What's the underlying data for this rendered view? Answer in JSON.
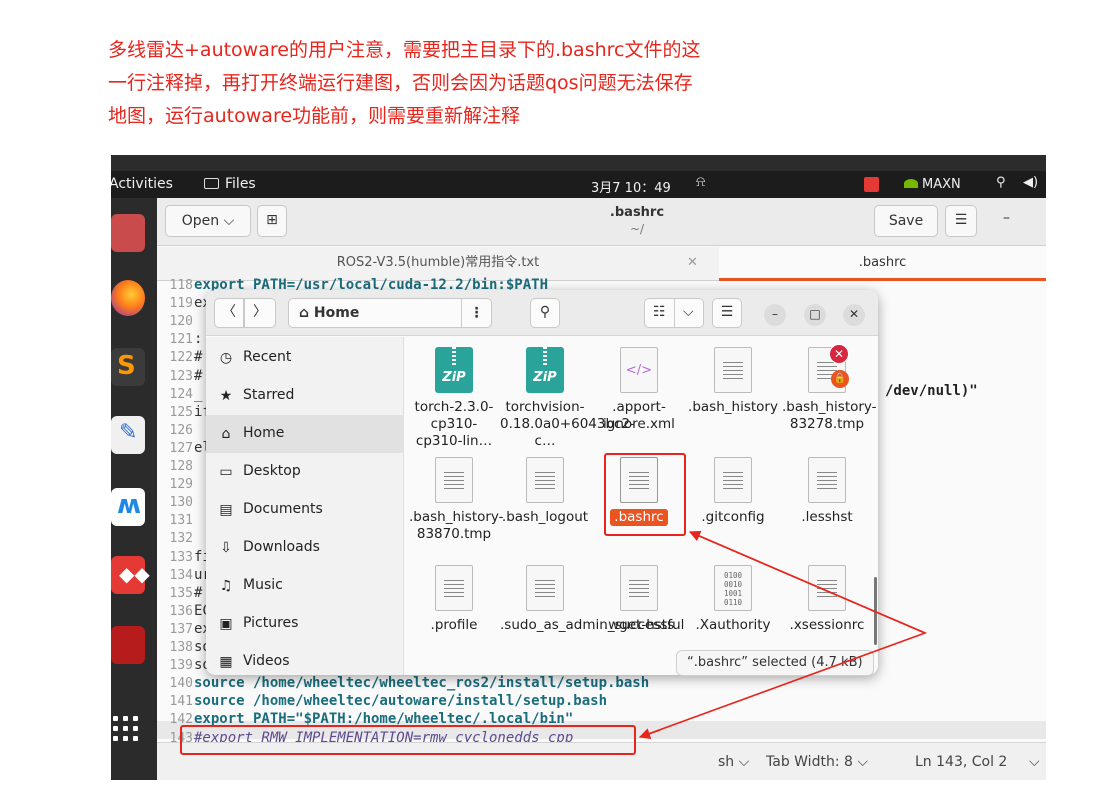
{
  "annotation": {
    "line1": "多线雷达+autoware的用户注意，需要把主目录下的.bashrc文件的这",
    "line2": "一行注释掉，再打开终端运行建图，否则会因为话题qos问题无法保存",
    "line3": "地图，运行autoware功能前，则需要重新解注释"
  },
  "topbar": {
    "activities": "Activities",
    "app": "Files",
    "clock": "3月7 10：49",
    "maxn": "MAXN"
  },
  "gedit": {
    "open_label": "Open",
    "save_label": "Save",
    "title": ".bashrc",
    "path": "~/",
    "tabs": [
      {
        "label": "ROS2-V3.5(humble)常用指令.txt"
      },
      {
        "label": ".bashrc"
      }
    ],
    "lines": [
      {
        "n": "118",
        "t": "export PATH=/usr/local/cuda-12.2/bin:$PATH"
      },
      {
        "n": "119",
        "t": "ex"
      },
      {
        "n": "120",
        "t": ""
      },
      {
        "n": "121",
        "t": ":"
      },
      {
        "n": "122",
        "t": "#"
      },
      {
        "n": "123",
        "t": "#"
      },
      {
        "n": "124",
        "t": "_"
      },
      {
        "n": "125",
        "t": "if"
      },
      {
        "n": "126",
        "t": ""
      },
      {
        "n": "127",
        "t": "el"
      },
      {
        "n": "128",
        "t": ""
      },
      {
        "n": "129",
        "t": ""
      },
      {
        "n": "130",
        "t": ""
      },
      {
        "n": "131",
        "t": ""
      },
      {
        "n": "132",
        "t": ""
      },
      {
        "n": "133",
        "t": "fi"
      },
      {
        "n": "134",
        "t": "ur"
      },
      {
        "n": "135",
        "t": "#"
      },
      {
        "n": "136",
        "t": "EC"
      },
      {
        "n": "137",
        "t": "ex"
      },
      {
        "n": "138",
        "t": "so"
      },
      {
        "n": "139",
        "t": "so"
      },
      {
        "n": "140",
        "t": "source /home/wheeltec/wheeltec_ros2/install/setup.bash"
      },
      {
        "n": "141",
        "t": "source /home/wheeltec/autoware/install/setup.bash"
      },
      {
        "n": "142",
        "t": "export PATH=\"$PATH:/home/wheeltec/.local/bin\""
      },
      {
        "n": "143",
        "t": "#export RMW_IMPLEMENTATION=rmw_cyclonedds_cpp"
      }
    ],
    "dev_null": "/dev/null)\"",
    "status": {
      "lang": "sh",
      "tab_width": "Tab Width: 8",
      "position": "Ln 143, Col 2"
    }
  },
  "files": {
    "location": "Home",
    "sidebar": [
      {
        "icon": "clock-icon",
        "glyph": "◷",
        "label": "Recent"
      },
      {
        "icon": "star-icon",
        "glyph": "★",
        "label": "Starred"
      },
      {
        "icon": "home-icon",
        "glyph": "⌂",
        "label": "Home"
      },
      {
        "icon": "desktop-icon",
        "glyph": "▭",
        "label": "Desktop"
      },
      {
        "icon": "documents-icon",
        "glyph": "▤",
        "label": "Documents"
      },
      {
        "icon": "downloads-icon",
        "glyph": "⇩",
        "label": "Downloads"
      },
      {
        "icon": "music-icon",
        "glyph": "♫",
        "label": "Music"
      },
      {
        "icon": "pictures-icon",
        "glyph": "▣",
        "label": "Pictures"
      },
      {
        "icon": "videos-icon",
        "glyph": "▦",
        "label": "Videos"
      }
    ],
    "items": [
      {
        "type": "zip",
        "name": "torch-2.3.0-cp310-cp310-lin…"
      },
      {
        "type": "zip",
        "name": "torchvision-0.18.0a0+6043bc2-c…"
      },
      {
        "type": "xml",
        "name": ".apport-ignore.xml"
      },
      {
        "type": "doc",
        "name": ".bash_history"
      },
      {
        "type": "doc-locked",
        "name": ".bash_history-83278.tmp"
      },
      {
        "type": "doc",
        "name": ".bash_history-83870.tmp"
      },
      {
        "type": "doc",
        "name": ".bash_logout"
      },
      {
        "type": "doc-selected",
        "name": ".bashrc"
      },
      {
        "type": "doc",
        "name": ".gitconfig"
      },
      {
        "type": "doc",
        "name": ".lesshst"
      },
      {
        "type": "doc",
        "name": ".profile"
      },
      {
        "type": "doc",
        "name": ".sudo_as_admin_successful"
      },
      {
        "type": "doc",
        "name": ".wget-hsts"
      },
      {
        "type": "bin",
        "name": ".Xauthority"
      },
      {
        "type": "doc",
        "name": ".xsessionrc"
      }
    ],
    "selection_status": "“.bashrc” selected (4.7 kB)"
  },
  "colors": {
    "annotation": "#e8251c",
    "accent": "#e95420",
    "zip": "#2aa39b"
  }
}
